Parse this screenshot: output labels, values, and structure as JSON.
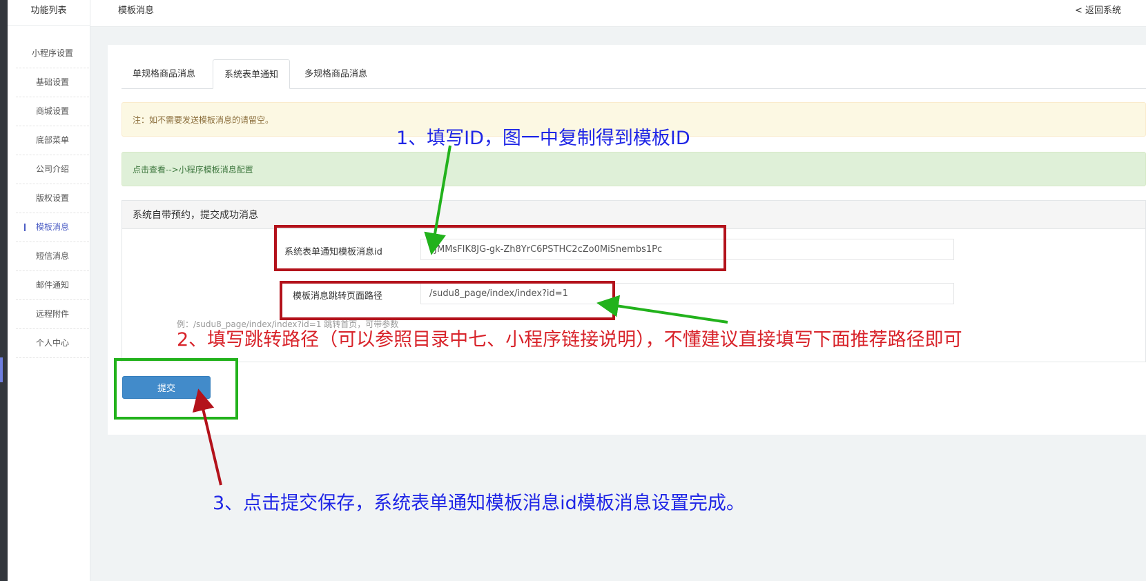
{
  "sidebar": {
    "title": "功能列表",
    "items": [
      {
        "label": "小程序设置"
      },
      {
        "label": "基础设置"
      },
      {
        "label": "商城设置"
      },
      {
        "label": "底部菜单"
      },
      {
        "label": "公司介绍"
      },
      {
        "label": "版权设置"
      },
      {
        "label": "模板消息",
        "active": true
      },
      {
        "label": "短信消息"
      },
      {
        "label": "邮件通知"
      },
      {
        "label": "远程附件"
      },
      {
        "label": "个人中心"
      }
    ]
  },
  "header": {
    "title": "模板消息",
    "back_label": "< 返回系统"
  },
  "tabs": [
    {
      "label": "单规格商品消息"
    },
    {
      "label": "系统表单通知",
      "active": true
    },
    {
      "label": "多规格商品消息"
    }
  ],
  "alerts": {
    "warning": "注：如不需要发送模板消息的请留空。",
    "success": "点击查看-->小程序模板消息配置"
  },
  "panel": {
    "heading": "系统自带预约，提交成功消息",
    "fields": {
      "template_id": {
        "label": "系统表单通知模板消息id",
        "value": "cJMMsFIK8JG-gk-Zh8YrC6PSTHC2cZo0MiSnembs1Pc"
      },
      "jump_path": {
        "label": "模板消息跳转页面路径",
        "value": "/sudu8_page/index/index?id=1"
      }
    },
    "help_text": "例：/sudu8_page/index/index?id=1 跳转首页，可带参数"
  },
  "submit_label": "提交",
  "annotations": {
    "step1": "1、填写ID，图一中复制得到模板ID",
    "step2": "2、填写跳转路径（可以参照目录中七、小程序链接说明），不懂建议直接填写下面推荐路径即可",
    "step3": "3、点击提交保存，系统表单通知模板消息id模板消息设置完成。"
  },
  "colors": {
    "annotation_blue": "#1f26e6",
    "annotation_red": "#d8232a",
    "highlight_red_box": "#b3121b",
    "highlight_green_box": "#22b21c",
    "primary_button": "#428bca",
    "active_nav": "#4b5cc4"
  }
}
